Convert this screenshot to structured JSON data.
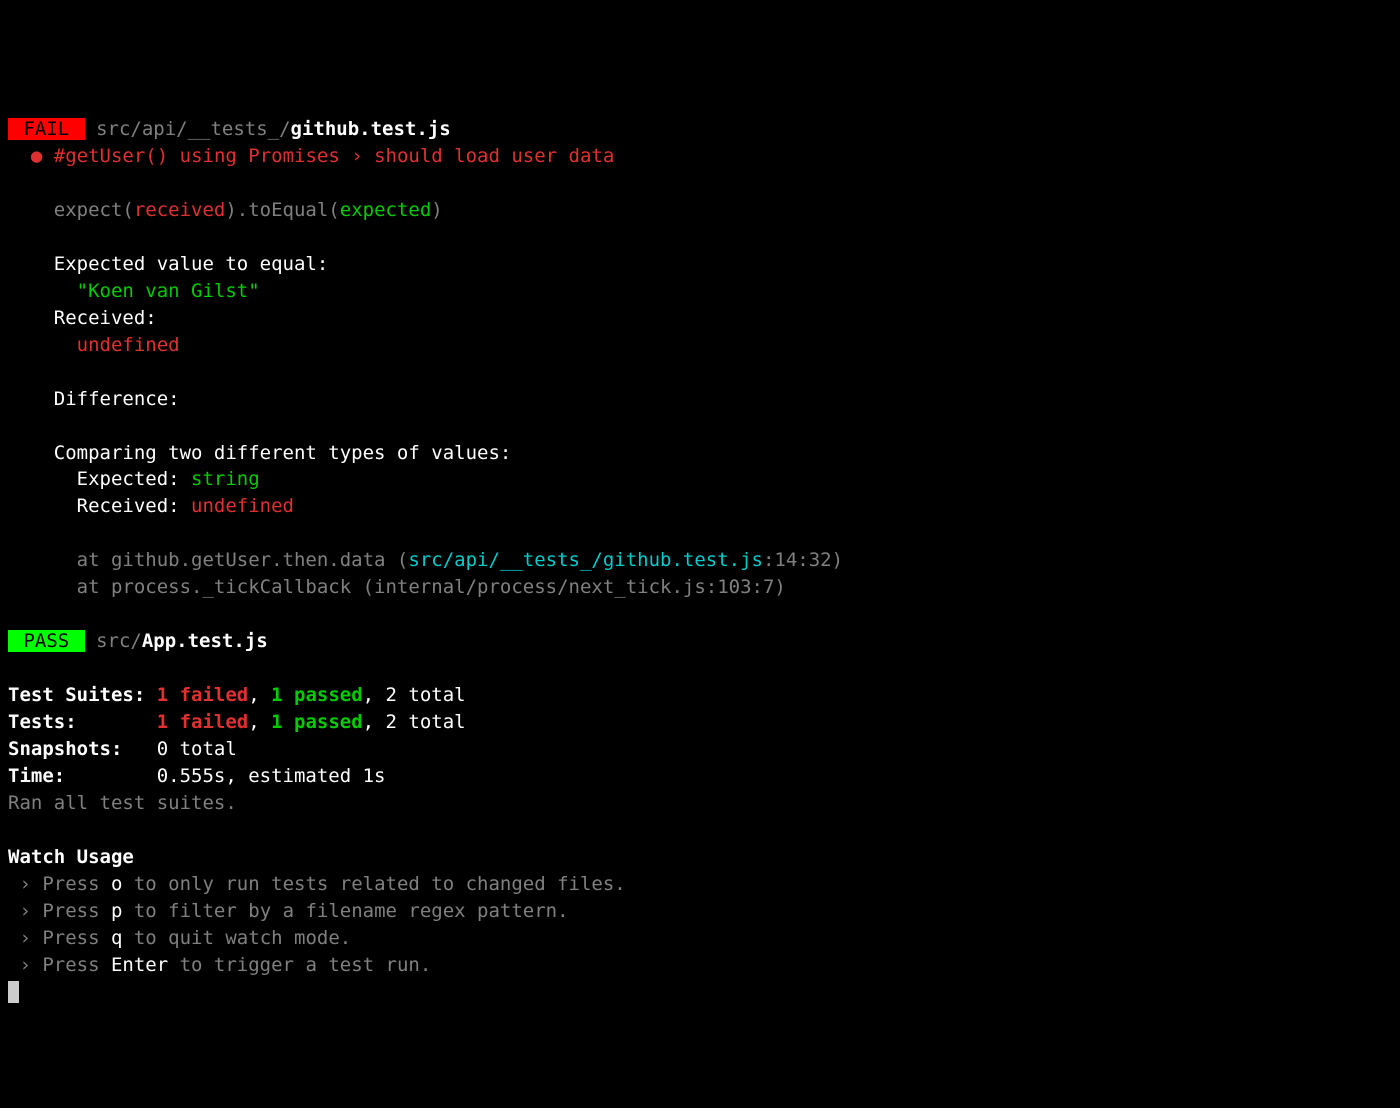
{
  "fail": {
    "badge": " FAIL ",
    "pathDim": " src/api/__tests_/",
    "pathWhite": "github.test.js"
  },
  "testName": "#getUser() using Promises › should load user data",
  "expectLine": {
    "p1": "expect(",
    "p2": "received",
    "p3": ").toEqual(",
    "p4": "expected",
    "p5": ")"
  },
  "expectedLabel": "Expected value to equal:",
  "expectedValue": "\"Koen van Gilst\"",
  "receivedLabel": "Received:",
  "receivedValue": "undefined",
  "differenceLabel": "Difference:",
  "comparingLabel": "Comparing two different types of values:",
  "expectedType": {
    "label": "Expected: ",
    "value": "string"
  },
  "receivedType": {
    "label": "Received: ",
    "value": "undefined"
  },
  "stack": {
    "line1": {
      "p1": "at github.getUser.then.data (",
      "p2": "src/api/__tests_/github.test.js",
      "p3": ":14:32)"
    },
    "line2": "at process._tickCallback (internal/process/next_tick.js:103:7)"
  },
  "pass": {
    "badge": " PASS ",
    "pathDim": " src/",
    "pathWhite": "App.test.js"
  },
  "summary": {
    "suites": {
      "label": "Test Suites: ",
      "failed": "1 failed",
      "sep1": ", ",
      "passed": "1 passed",
      "sep2": ", ",
      "total": "2 total"
    },
    "tests": {
      "label": "Tests:       ",
      "failed": "1 failed",
      "sep1": ", ",
      "passed": "1 passed",
      "sep2": ", ",
      "total": "2 total"
    },
    "snapshots": {
      "label": "Snapshots:   ",
      "value": "0 total"
    },
    "time": {
      "label": "Time:        ",
      "value": "0.555s, estimated 1s"
    },
    "ran": "Ran all test suites."
  },
  "watch": {
    "title": "Watch Usage",
    "items": [
      {
        "prefix": " › ",
        "press": "Press ",
        "key": "o",
        "desc": " to only run tests related to changed files."
      },
      {
        "prefix": " › ",
        "press": "Press ",
        "key": "p",
        "desc": " to filter by a filename regex pattern."
      },
      {
        "prefix": " › ",
        "press": "Press ",
        "key": "q",
        "desc": " to quit watch mode."
      },
      {
        "prefix": " › ",
        "press": "Press ",
        "key": "Enter",
        "desc": " to trigger a test run."
      }
    ]
  }
}
